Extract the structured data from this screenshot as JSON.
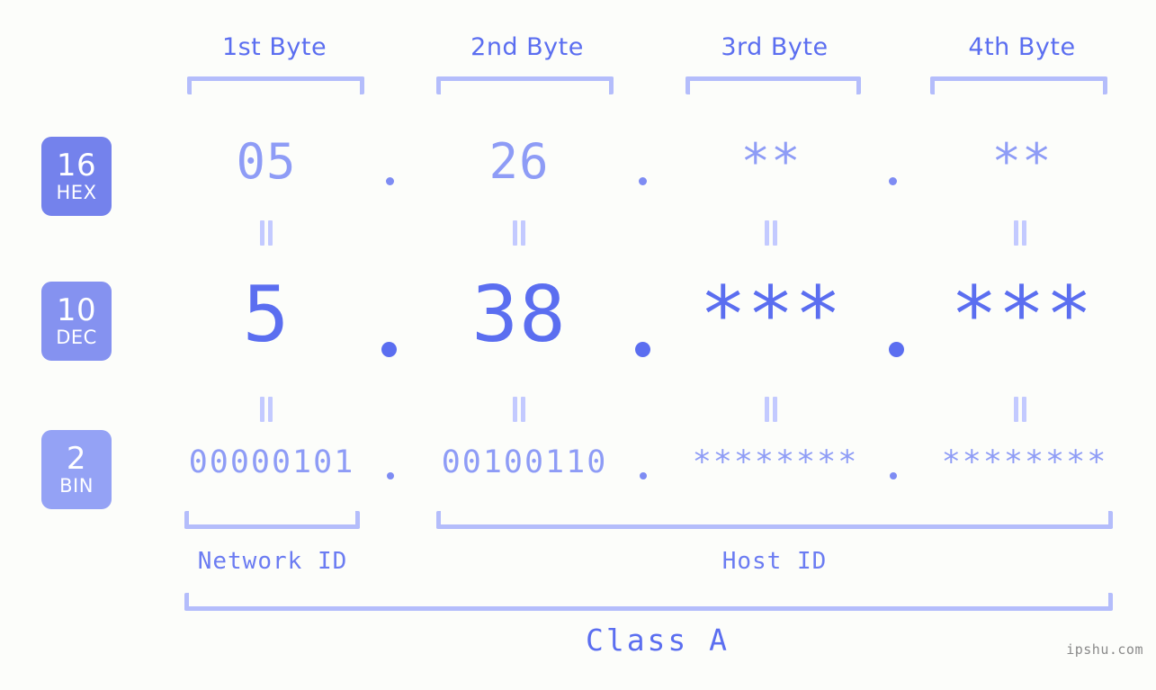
{
  "background_color": "#fcfdfa",
  "accent_color": "#5b6ef0",
  "accent_light": "#8e9cf6",
  "bracket_color": "#b4bdfb",
  "headers": [
    {
      "label": "1st Byte"
    },
    {
      "label": "2nd Byte"
    },
    {
      "label": "3rd Byte"
    },
    {
      "label": "4th Byte"
    }
  ],
  "bases": [
    {
      "number": "16",
      "name": "HEX",
      "color": "#7482ec"
    },
    {
      "number": "10",
      "name": "DEC",
      "color": "#8592f0"
    },
    {
      "number": "2",
      "name": "BIN",
      "color": "#94a2f5"
    }
  ],
  "rows": {
    "hex": {
      "bytes": [
        "05",
        "26",
        "**",
        "**"
      ],
      "separator": "."
    },
    "dec": {
      "bytes": [
        "5",
        "38",
        "***",
        "***"
      ],
      "separator": "."
    },
    "bin": {
      "bytes": [
        "00000101",
        "00100110",
        "********",
        "********"
      ],
      "separator": "."
    }
  },
  "equals_symbol": "=",
  "sections": [
    {
      "label": "Network ID"
    },
    {
      "label": "Host ID"
    }
  ],
  "class": {
    "label": "Class A"
  },
  "watermark": {
    "text": "ipshu.com"
  }
}
